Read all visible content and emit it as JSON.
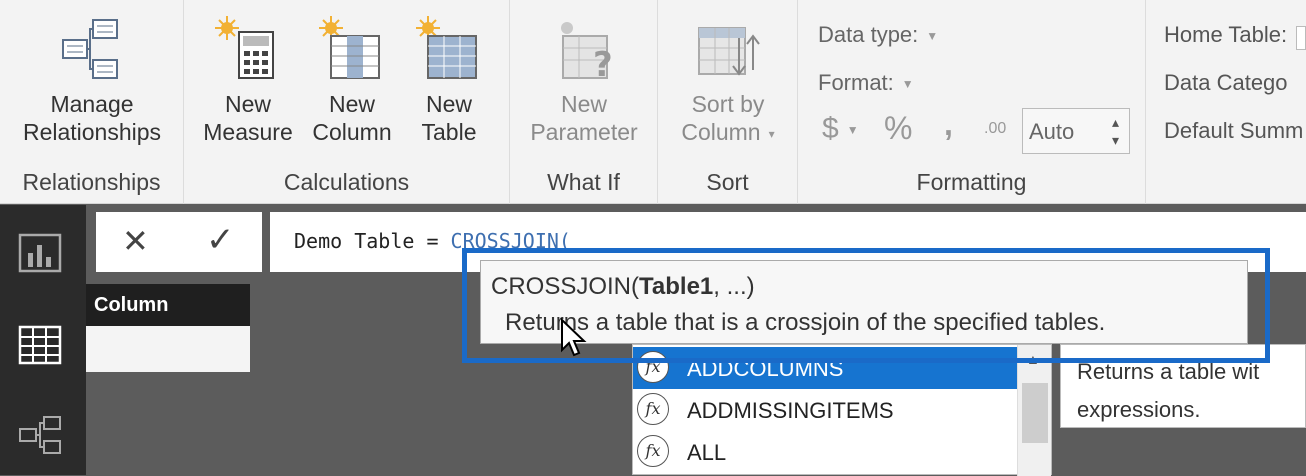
{
  "ribbon": {
    "relationships": {
      "manage_line1": "Manage",
      "manage_line2": "Relationships",
      "group_label": "Relationships"
    },
    "calculations": {
      "new_measure_1": "New",
      "new_measure_2": "Measure",
      "new_column_1": "New",
      "new_column_2": "Column",
      "new_table_1": "New",
      "new_table_2": "Table",
      "group_label": "Calculations"
    },
    "whatif": {
      "param_1": "New",
      "param_2": "Parameter",
      "group_label": "What If"
    },
    "sort": {
      "sort_1": "Sort by",
      "sort_2": "Column",
      "group_label": "Sort"
    },
    "formatting": {
      "data_type": "Data type:",
      "format": "Format:",
      "currency": "$",
      "percent": "%",
      "comma": ",",
      "decimal": ".00",
      "auto": "Auto",
      "group_label": "Formatting"
    },
    "properties": {
      "home_table": "Home Table:",
      "data_category": "Data Catego",
      "default_summ": "Default Summ"
    }
  },
  "formula_bar": {
    "cancel": "✕",
    "commit": "✓",
    "prefix": "Demo Table = ",
    "func": "CROSSJOIN("
  },
  "table": {
    "column_header": "Column"
  },
  "tooltip": {
    "sig_pre": "CROSSJOIN(",
    "sig_bold": "Table1",
    "sig_post": ", ...)",
    "description": "Returns a table that is a crossjoin of the specified tables."
  },
  "autocomplete": {
    "fx_glyph": "fx",
    "items": [
      {
        "label": "ADDCOLUMNS"
      },
      {
        "label": "ADDMISSINGITEMS"
      },
      {
        "label": "ALL"
      }
    ],
    "description_line1": "Returns a table wit",
    "description_line2": "expressions."
  },
  "colors": {
    "accent": "#1674d0",
    "highlight_border": "#1a6ac8",
    "func_blue": "#3e6fb0"
  }
}
